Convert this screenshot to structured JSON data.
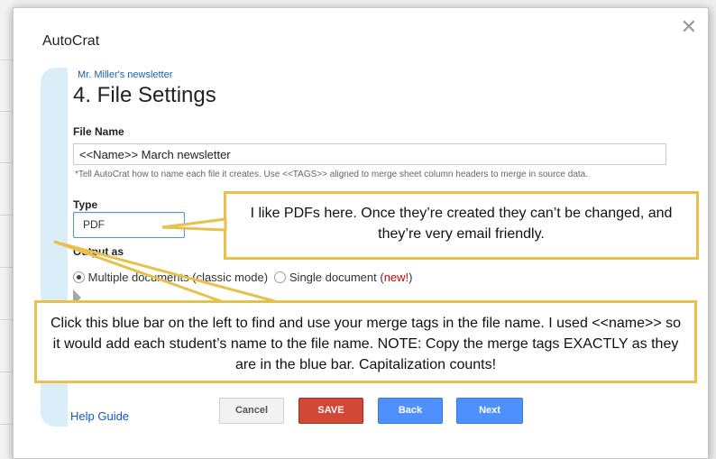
{
  "dialog": {
    "title": "AutoCrat",
    "close_icon": "✕"
  },
  "breadcrumb": "Mr. Miller's newsletter",
  "heading": "4. File Settings",
  "file_name": {
    "label": "File Name",
    "value": "<<Name>> March newsletter",
    "hint": "*Tell AutoCrat how to name each file it creates. Use <<TAGS>> aligned to merge sheet column headers to merge in source data."
  },
  "type": {
    "label": "Type",
    "selected": "PDF"
  },
  "output": {
    "label": "Output as",
    "option_multiple": "Multiple documents (classic mode)",
    "option_single": "Single document",
    "new_prefix": " (",
    "new_tag": "new!",
    "new_suffix": ")"
  },
  "help_link": "Help Guide",
  "buttons": {
    "cancel": "Cancel",
    "save": "SAVE",
    "back": "Back",
    "next": "Next"
  },
  "callouts": {
    "pdf": "I like PDFs here. Once they’re created they can’t be changed, and they’re very email friendly.",
    "blue_bar": "Click this blue bar on the left to find and use your merge tags in the file name. I used <<name>> so it would add each student’s name to the file name. NOTE: Copy the merge tags EXACTLY as they are in the blue bar. Capitalization counts!"
  },
  "colors": {
    "accent_blue": "#4d90fe",
    "save_red": "#d14836",
    "callout_border": "#e8c04e",
    "blue_bar": "#daeefa"
  }
}
